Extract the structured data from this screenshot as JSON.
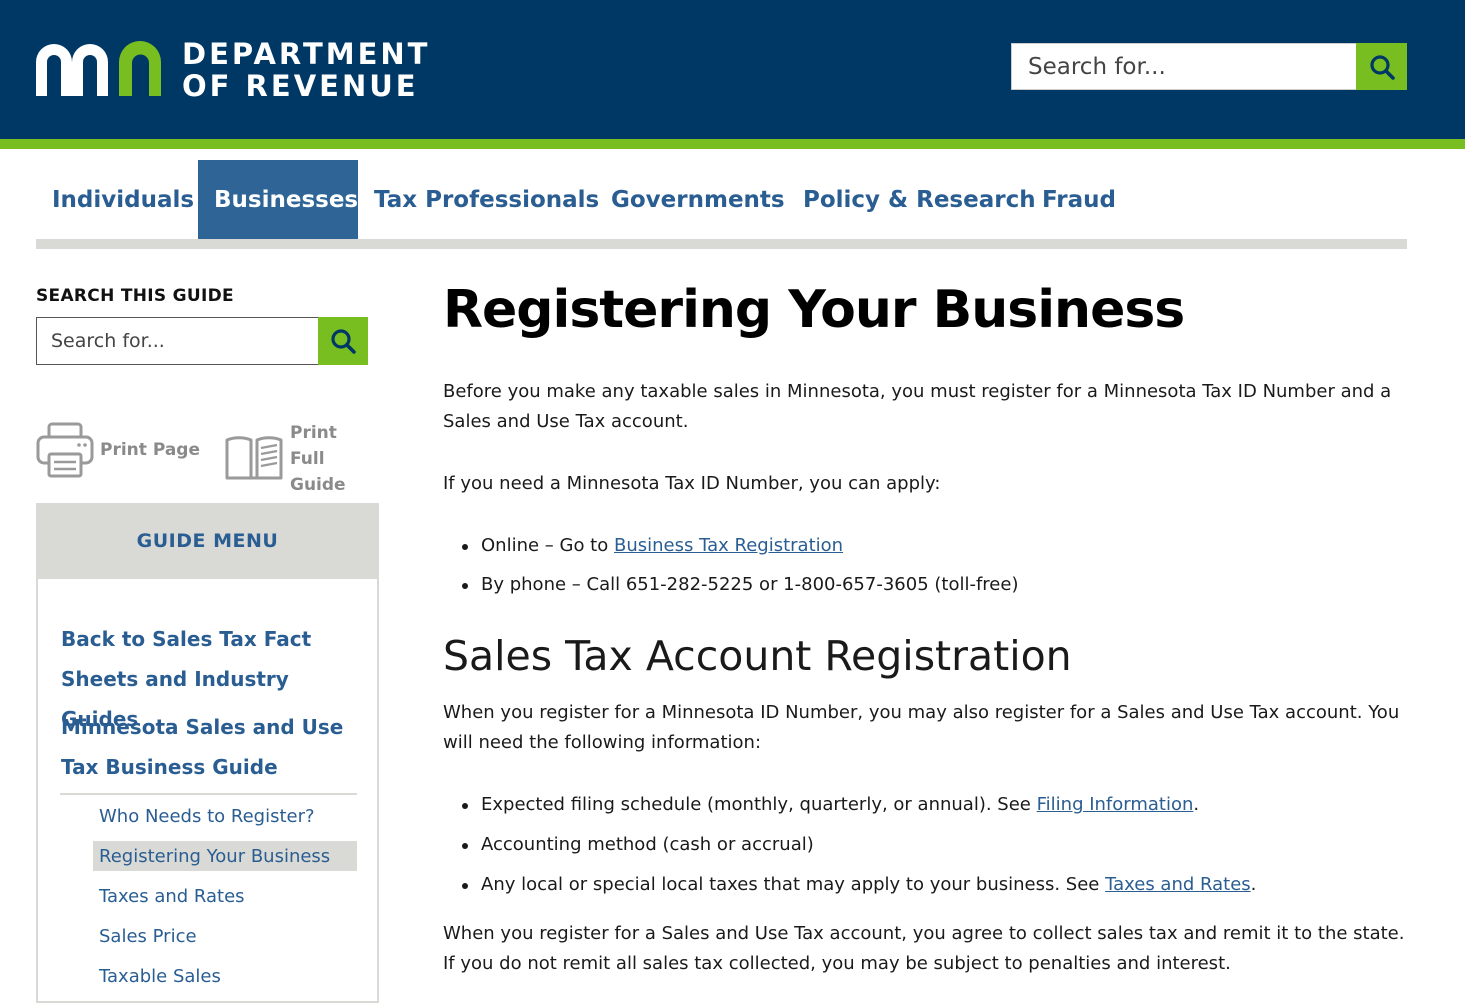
{
  "header": {
    "logo_line1": "DEPARTMENT",
    "logo_line2": "OF REVENUE",
    "search_placeholder": "Search for...",
    "colors": {
      "navy": "#003865",
      "green": "#78be21"
    }
  },
  "nav": {
    "items": [
      {
        "label": "Individuals",
        "active": false
      },
      {
        "label": "Businesses",
        "active": true
      },
      {
        "label": "Tax Professionals",
        "active": false
      },
      {
        "label": "Governments",
        "active": false
      },
      {
        "label": "Policy & Research",
        "active": false
      },
      {
        "label": "Fraud",
        "active": false
      }
    ]
  },
  "sidebar": {
    "search_title": "SEARCH THIS GUIDE",
    "search_placeholder": "Search for...",
    "print_page": "Print Page",
    "print_full_guide_1": "Print",
    "print_full_guide_2": "Full Guide",
    "menu_title": "GUIDE MENU",
    "top_links": [
      "Back to Sales Tax Fact Sheets and Industry Guides",
      "Minnesota Sales and Use Tax Business Guide"
    ],
    "sub_links": [
      "Who Needs to Register?",
      "Registering Your Business",
      "Taxes and Rates",
      "Sales Price",
      "Taxable Sales"
    ],
    "current_sub": "Registering Your Business"
  },
  "main": {
    "title": "Registering Your Business",
    "intro": "Before you make any taxable sales in Minnesota, you must register for a Minnesota Tax ID Number and a Sales and Use Tax account.",
    "apply_text": "If you need a Minnesota Tax ID Number, you can apply:",
    "apply_list": {
      "online_prefix": "Online – Go to ",
      "online_link": "Business Tax Registration",
      "phone": "By phone – Call 651-282-5225 or 1-800-657-3605 (toll-free)"
    },
    "section_heading": "Sales Tax Account Registration",
    "section_intro": "When you register for a Minnesota ID Number, you may also register for a Sales and Use Tax account. You will need the following information:",
    "info_list": {
      "filing_prefix": "Expected filing schedule (monthly, quarterly, or annual). See ",
      "filing_link": "Filing Information",
      "filing_suffix": ".",
      "accounting": "Accounting method (cash or accrual)",
      "local_prefix": "Any local or special local taxes that may apply to your business. See ",
      "local_link": "Taxes and Rates",
      "local_suffix": "."
    },
    "closing": "When you register for a Sales and Use Tax account, you agree to collect sales tax and remit it to the state. If you do not remit all sales tax collected, you may be subject to penalties and interest."
  }
}
